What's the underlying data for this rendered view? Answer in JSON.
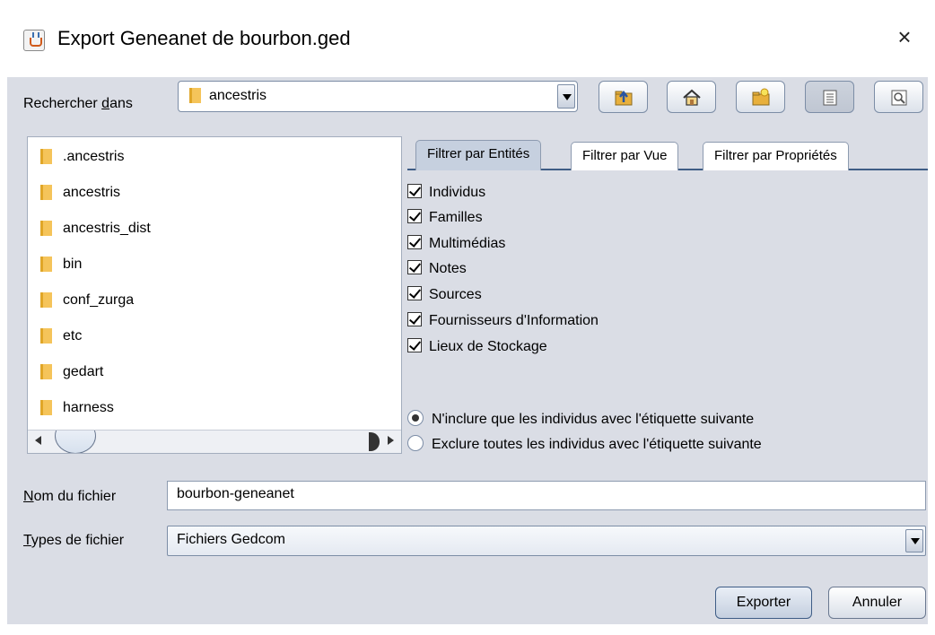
{
  "window": {
    "title": "Export Geneanet de bourbon.ged",
    "close_glyph": "×"
  },
  "look_in": {
    "label_before": "Rechercher ",
    "label_underlined": "d",
    "label_after": "ans",
    "current_folder": "ancestris"
  },
  "toolbar": {
    "buttons": [
      {
        "name": "up-one-level-button",
        "icon": "folder-up-icon"
      },
      {
        "name": "home-button",
        "icon": "home-icon"
      },
      {
        "name": "new-folder-button",
        "icon": "new-folder-icon"
      },
      {
        "name": "list-view-button",
        "icon": "list-icon"
      },
      {
        "name": "details-view-button",
        "icon": "details-icon"
      }
    ]
  },
  "file_list": {
    "items": [
      ".ancestris",
      "ancestris",
      "ancestris_dist",
      "bin",
      "conf_zurga",
      "etc",
      "gedart",
      "harness"
    ]
  },
  "tabs": [
    {
      "label": "Filtrer par Entités",
      "active": true
    },
    {
      "label": "Filtrer par Vue",
      "active": false
    },
    {
      "label": "Filtrer par Propriétés",
      "active": false
    }
  ],
  "entity_filters": [
    {
      "label": "Individus",
      "checked": true
    },
    {
      "label": "Familles",
      "checked": true
    },
    {
      "label": "Multimédias",
      "checked": true
    },
    {
      "label": "Notes",
      "checked": true
    },
    {
      "label": "Sources",
      "checked": true
    },
    {
      "label": "Fournisseurs d'Information",
      "checked": true
    },
    {
      "label": "Lieux de Stockage",
      "checked": true
    }
  ],
  "tag_options": [
    {
      "label": "N'inclure que les individus avec l'étiquette suivante",
      "selected": true
    },
    {
      "label": "Exclure toutes les individus avec l'étiquette suivante",
      "selected": false
    }
  ],
  "file_name": {
    "label_underlined": "N",
    "label_rest": "om du fichier",
    "value": "bourbon-geneanet"
  },
  "file_type": {
    "label_underlined": "T",
    "label_rest": "ypes de fichier",
    "value": "Fichiers Gedcom"
  },
  "actions": {
    "export_label": "Exporter",
    "cancel_label": "Annuler"
  },
  "colors": {
    "dialog_bg": "#dadde5",
    "accent": "#3f5d86",
    "folder": "#f5c45a"
  }
}
